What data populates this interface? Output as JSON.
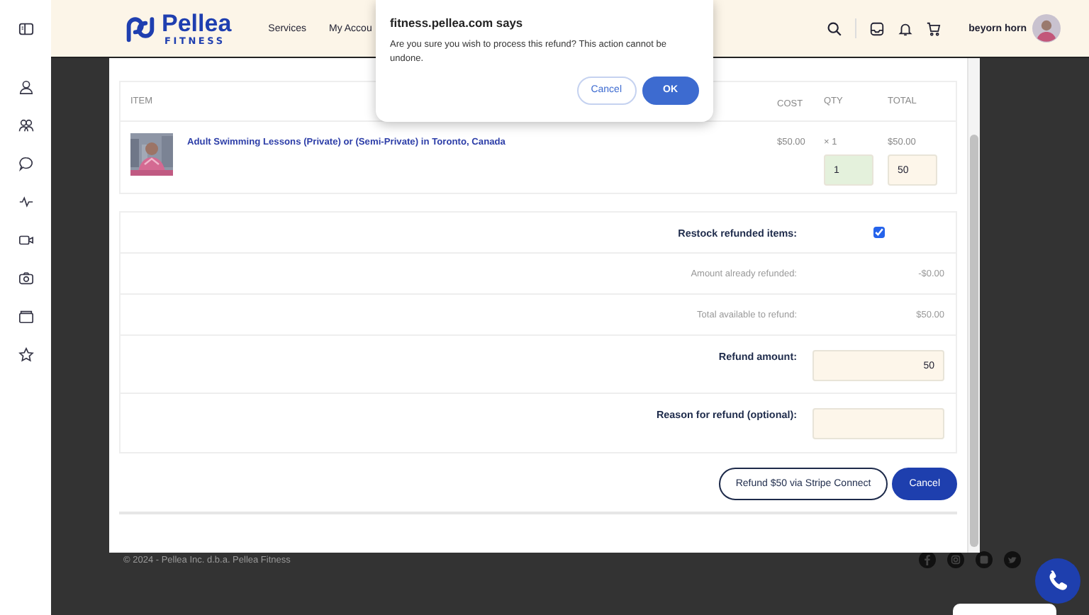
{
  "header": {
    "logo": {
      "name": "Pellea",
      "tagline": "FITNESS"
    },
    "nav": [
      "Services",
      "My Accou"
    ],
    "user": {
      "name": "beyorn horn"
    }
  },
  "modal": {
    "table": {
      "columns": [
        "ITEM",
        "COST",
        "QTY",
        "TOTAL"
      ],
      "rows": [
        {
          "item": "Adult Swimming Lessons (Private) or (Semi-Private) in Toronto, Canada",
          "cost": "$50.00",
          "qty_label": "× 1",
          "qty": "1",
          "total_label": "$50.00",
          "total": "50"
        }
      ]
    },
    "refund_form": {
      "restock": {
        "label": "Restock refunded items:",
        "checked": true
      },
      "summary": [
        {
          "label": "Amount already refunded:",
          "value": "-$0.00"
        },
        {
          "label": "Total available to refund:",
          "value": "$50.00"
        }
      ],
      "amount": {
        "label": "Refund amount:",
        "value": "50"
      },
      "reason": {
        "label": "Reason for refund (optional):"
      }
    },
    "buttons": [
      {
        "label": "Refund $50 via Stripe Connect",
        "kind": "outline"
      },
      {
        "label": "Cancel",
        "kind": "primary"
      }
    ]
  },
  "footer": {
    "copyright": "© 2024 - Pellea Inc. d.b.a. Pellea Fitness"
  },
  "alert": {
    "title": "fitness.pellea.com says",
    "message": "Are you sure you wish to process this refund? This action cannot be undone.",
    "buttons": [
      {
        "label": "Cancel",
        "kind": "outline"
      },
      {
        "label": "OK",
        "kind": "primary"
      }
    ]
  }
}
